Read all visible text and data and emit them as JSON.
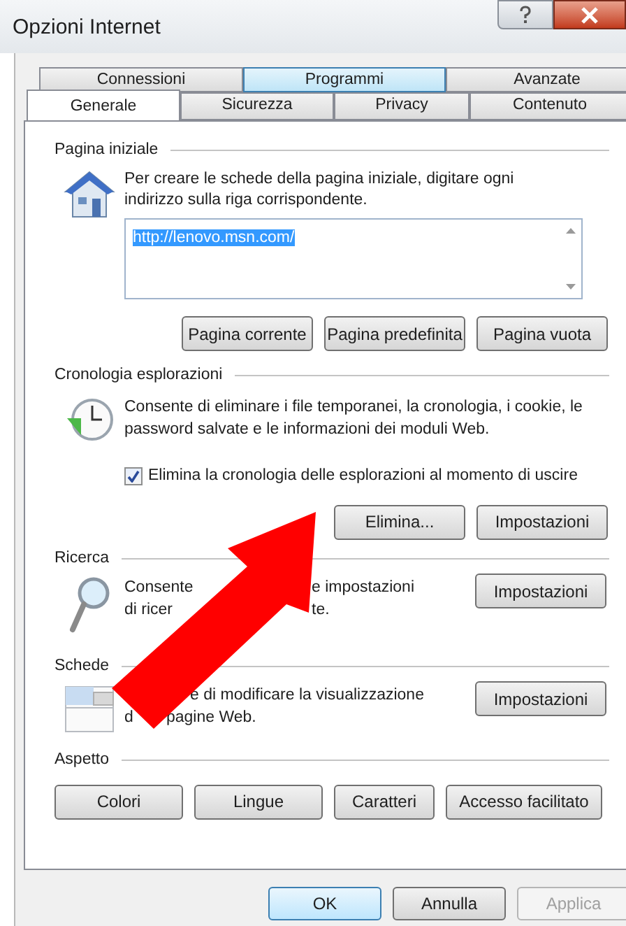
{
  "window": {
    "title": "Opzioni Internet"
  },
  "tab_rows": [
    [
      {
        "label": "Connessioni",
        "selected": false,
        "hovered": false
      },
      {
        "label": "Programmi",
        "selected": false,
        "hovered": true
      },
      {
        "label": "Avanzate",
        "selected": false,
        "hovered": false
      }
    ],
    [
      {
        "label": "Generale",
        "selected": true,
        "hovered": false
      },
      {
        "label": "Sicurezza",
        "selected": false,
        "hovered": false
      },
      {
        "label": "Privacy",
        "selected": false,
        "hovered": false
      },
      {
        "label": "Contenuto",
        "selected": false,
        "hovered": false
      }
    ]
  ],
  "home_page": {
    "title": "Pagina iniziale",
    "description": "Per creare le schede della pagina iniziale, digitare ogni indirizzo sulla riga corrispondente.",
    "url": "http://lenovo.msn.com/",
    "buttons": [
      "Pagina corrente",
      "Pagina predefinita",
      "Pagina vuota"
    ]
  },
  "history": {
    "title": "Cronologia esplorazioni",
    "description": "Consente di eliminare i file temporanei, la cronologia, i cookie, le password salvate e le informazioni dei moduli Web.",
    "checkbox": {
      "label": "Elimina la cronologia delle esplorazioni al momento di uscire",
      "checked": true
    },
    "buttons": [
      "Elimina...",
      "Impostazioni"
    ]
  },
  "search": {
    "title": "Ricerca",
    "description_lines": [
      [
        "Consente",
        "e impostazioni"
      ],
      [
        "di ricer",
        "te."
      ]
    ],
    "button": "Impostazioni"
  },
  "tabs_section": {
    "title": "Schede",
    "description_lines": [
      [
        "e di modificare la visualizzazione"
      ],
      [
        "d",
        "pagine Web."
      ]
    ],
    "button": "Impostazioni"
  },
  "appearance": {
    "title": "Aspetto",
    "buttons": [
      "Colori",
      "Lingue",
      "Caratteri",
      "Accesso facilitato"
    ]
  },
  "footer_buttons": [
    {
      "label": "OK",
      "default": true,
      "disabled": false
    },
    {
      "label": "Annulla",
      "default": false,
      "disabled": false
    },
    {
      "label": "Applica",
      "default": false,
      "disabled": true
    }
  ]
}
